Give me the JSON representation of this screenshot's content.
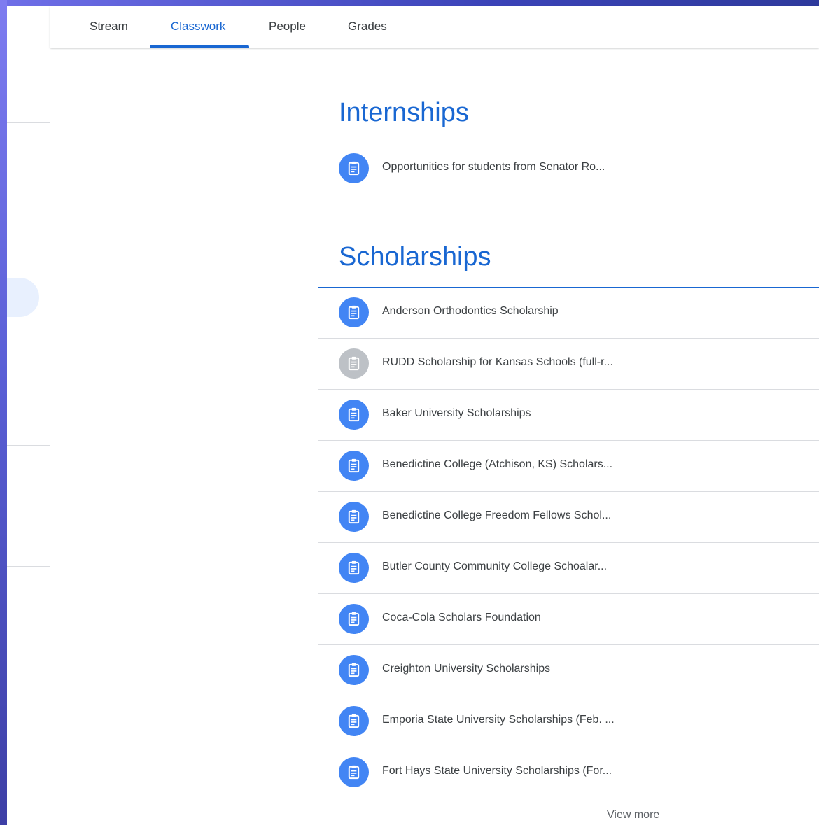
{
  "tabs": [
    {
      "label": "Stream",
      "active": false
    },
    {
      "label": "Classwork",
      "active": true
    },
    {
      "label": "People",
      "active": false
    },
    {
      "label": "Grades",
      "active": false
    }
  ],
  "sections": [
    {
      "title": "Internships",
      "items": [
        {
          "label": "Opportunities for students from Senator Ro...",
          "icon": "assignment-icon",
          "muted": false
        }
      ]
    },
    {
      "title": "Scholarships",
      "items": [
        {
          "label": "Anderson Orthodontics Scholarship",
          "icon": "assignment-icon",
          "muted": false
        },
        {
          "label": "RUDD Scholarship for Kansas Schools (full-r...",
          "icon": "assignment-icon",
          "muted": true
        },
        {
          "label": "Baker University Scholarships",
          "icon": "assignment-icon",
          "muted": false
        },
        {
          "label": "Benedictine College (Atchison, KS) Scholars...",
          "icon": "assignment-icon",
          "muted": false
        },
        {
          "label": "Benedictine College Freedom Fellows Schol...",
          "icon": "assignment-icon",
          "muted": false
        },
        {
          "label": "Butler County Community College Schoalar...",
          "icon": "assignment-icon",
          "muted": false
        },
        {
          "label": "Coca-Cola Scholars Foundation",
          "icon": "assignment-icon",
          "muted": false
        },
        {
          "label": "Creighton University Scholarships",
          "icon": "assignment-icon",
          "muted": false
        },
        {
          "label": "Emporia State University Scholarships (Feb. ...",
          "icon": "assignment-icon",
          "muted": false
        },
        {
          "label": "Fort Hays State University Scholarships (For...",
          "icon": "assignment-icon",
          "muted": false
        }
      ],
      "view_more": "View more"
    }
  ],
  "colors": {
    "accent": "#1967d2",
    "icon_active": "#4285f4",
    "icon_muted": "#bdc1c6"
  }
}
